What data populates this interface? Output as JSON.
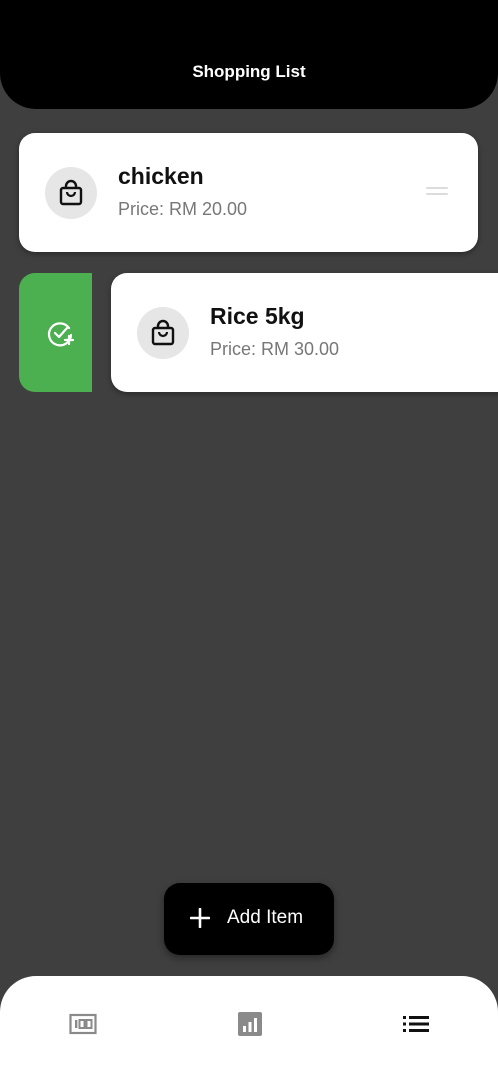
{
  "app_bar": {
    "title": "Shopping List"
  },
  "items": [
    {
      "name": "chicken",
      "price": "Price: RM 20.00",
      "icon": "shopping-bag-icon"
    },
    {
      "name": "Rice 5kg",
      "price": "Price: RM 30.00",
      "icon": "shopping-bag-icon"
    }
  ],
  "swipe_action": {
    "icon": "check-add-icon",
    "color": "#4caf50"
  },
  "fab": {
    "label": "Add Item",
    "icon": "plus-icon"
  },
  "bottom_nav": [
    {
      "icon": "money-icon",
      "active": false
    },
    {
      "icon": "bar-chart-icon",
      "active": false
    },
    {
      "icon": "list-icon",
      "active": true
    }
  ],
  "colors": {
    "background": "#3f3f3f",
    "appbar": "#000000",
    "card": "#ffffff",
    "accent": "#4caf50"
  }
}
